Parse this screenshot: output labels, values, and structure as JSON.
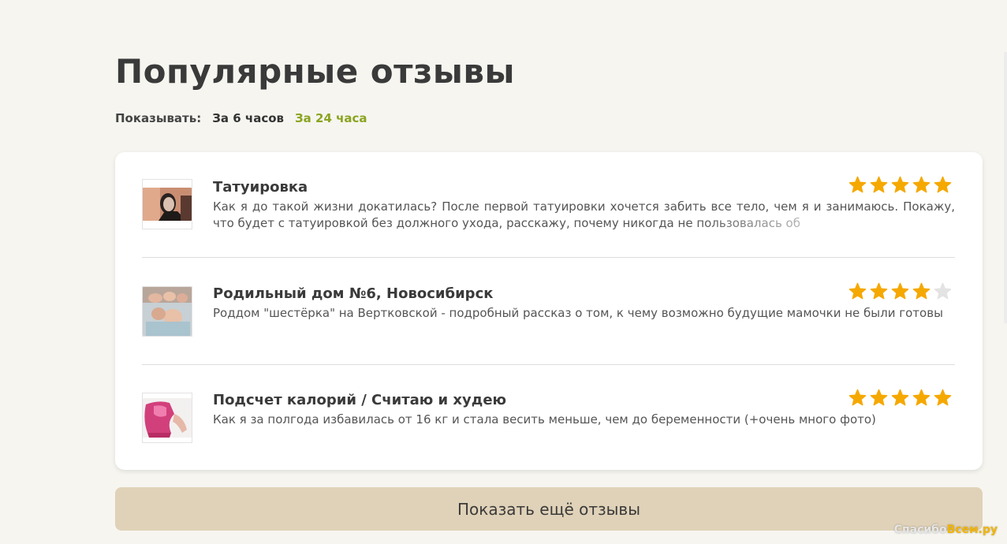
{
  "page": {
    "title": "Популярные отзывы"
  },
  "filter": {
    "label": "Показывать:",
    "options": [
      {
        "label": "За 6 часов",
        "active": false
      },
      {
        "label": "За 24 часа",
        "active": true
      }
    ]
  },
  "reviews": [
    {
      "title": "Татуировка",
      "text": "Как я до такой жизни докатилась? После первой татуировки хочется забить все тело, чем я и занимаюсь. Покажу, что будет с татуировкой без должного ухода, расскажу, почему никогда не пользовалась об",
      "rating": 5,
      "thumb": "tattoo-photo"
    },
    {
      "title": "Родильный дом №6, Новосибирск",
      "text": "Роддом \"шестёрка\" на Вертковской - подробный рассказ о том, к чему возможно будущие мамочки не были готовы",
      "rating": 4,
      "thumb": "newborns-photo"
    },
    {
      "title": "Подсчет калорий / Считаю и худею",
      "text": "Как я за полгода избавилась от 16 кг и стала весить меньше, чем до беременности (+очень много фото)",
      "rating": 5,
      "thumb": "body-photo"
    }
  ],
  "more_button": {
    "label": "Показать ещё отзывы"
  },
  "watermark": {
    "text_a": "Спасибо",
    "text_b": "Всем.ру"
  },
  "colors": {
    "accent_green": "#8aa420",
    "star_filled": "#f5a800",
    "star_empty": "#e3e3e3",
    "button_bg": "#e0d2b8"
  }
}
